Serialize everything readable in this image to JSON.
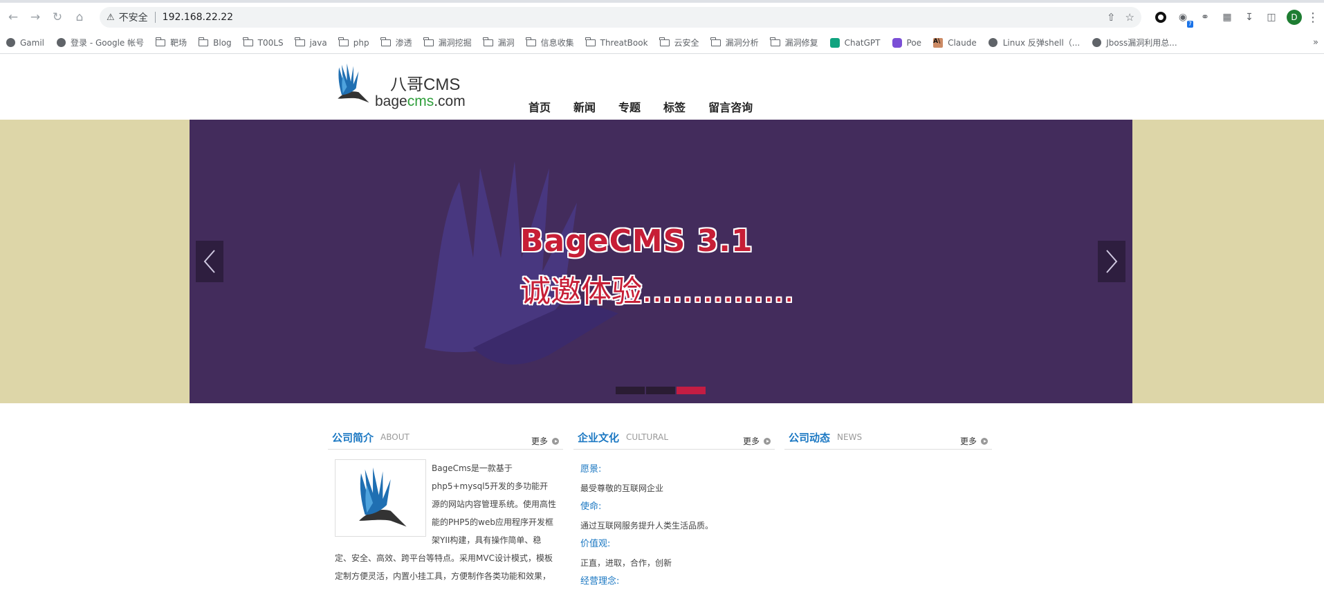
{
  "browser": {
    "insecure_label": "不安全",
    "url": "192.168.22.22",
    "profile_initial": "D",
    "extension_badge": "7",
    "bookmarks": [
      {
        "label": "Gamil",
        "icon": "globe-icon"
      },
      {
        "label": "登录 - Google 帐号",
        "icon": "globe-icon"
      },
      {
        "label": "靶场",
        "icon": "folder-icon"
      },
      {
        "label": "Blog",
        "icon": "folder-icon"
      },
      {
        "label": "T00LS",
        "icon": "folder-icon"
      },
      {
        "label": "java",
        "icon": "folder-icon"
      },
      {
        "label": "php",
        "icon": "folder-icon"
      },
      {
        "label": "渗透",
        "icon": "folder-icon"
      },
      {
        "label": "漏洞挖掘",
        "icon": "folder-icon"
      },
      {
        "label": "漏洞",
        "icon": "folder-icon"
      },
      {
        "label": "信息收集",
        "icon": "folder-icon"
      },
      {
        "label": "ThreatBook",
        "icon": "folder-icon"
      },
      {
        "label": "云安全",
        "icon": "folder-icon"
      },
      {
        "label": "漏洞分析",
        "icon": "folder-icon"
      },
      {
        "label": "漏洞修复",
        "icon": "folder-icon"
      },
      {
        "label": "ChatGPT",
        "icon": "chatgpt-icon"
      },
      {
        "label": "Poe",
        "icon": "poe-icon"
      },
      {
        "label": "Claude",
        "icon": "claude-icon"
      },
      {
        "label": "Linux 反弹shell（...",
        "icon": "globe-icon"
      },
      {
        "label": "Jboss漏洞利用总...",
        "icon": "globe-icon"
      }
    ],
    "more_bookmarks": "»"
  },
  "site": {
    "logo": {
      "cn": "八哥CMS",
      "en_prefix": "bage",
      "en_mid": "cms",
      "en_suffix": ".com"
    },
    "nav": [
      "首页",
      "新闻",
      "专题",
      "标签",
      "留言咨询"
    ],
    "banner": {
      "title": "BageCMS 3.1",
      "subtitle": "诚邀体验……………",
      "slide_count": 3,
      "active_slide": 3
    },
    "columns": {
      "about": {
        "title": "公司简介",
        "title_en": "ABOUT",
        "more": "更多",
        "text": "BageCms是一款基于php5+mysql5开发的多功能开源的网站内容管理系统。使用高性能的PHP5的web应用程序开发框架YII构建，具有操作简单、稳定、安全、高效、跨平台等特点。采用MVC设计模式，模板定制方便灵活，内置小挂工具，方便制作各类功能和效果，"
      },
      "culture": {
        "title": "企业文化",
        "title_en": "CULTURAL",
        "more": "更多",
        "items": [
          {
            "label": "愿景:",
            "text": "最受尊敬的互联网企业"
          },
          {
            "label": "使命:",
            "text": "通过互联网服务提升人类生活品质。"
          },
          {
            "label": "价值观:",
            "text": "正直，进取，合作，创新"
          },
          {
            "label": "经营理念:",
            "text": ""
          }
        ]
      },
      "news": {
        "title": "公司动态",
        "title_en": "NEWS",
        "more": "更多"
      }
    }
  },
  "colors": {
    "banner_bg": "#ddd6a8",
    "slide_bg": "#432c5c",
    "accent_blue": "#1a77c2",
    "accent_red": "#c71e36"
  }
}
